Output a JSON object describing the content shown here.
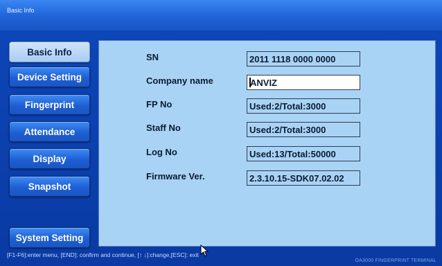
{
  "window": {
    "title": "Basic Info"
  },
  "sidebar": {
    "items": [
      {
        "label": "Basic Info"
      },
      {
        "label": "Device Setting"
      },
      {
        "label": "Fingerprint"
      },
      {
        "label": "Attendance"
      },
      {
        "label": "Display"
      },
      {
        "label": "Snapshot"
      },
      {
        "label": "System Setting"
      }
    ]
  },
  "info": {
    "fields": [
      {
        "label": "SN",
        "value": "2011 1118 0000 0000"
      },
      {
        "label": "Company name",
        "value": "ANVIZ"
      },
      {
        "label": "FP No",
        "value": "Used:2/Total:3000"
      },
      {
        "label": "Staff No",
        "value": "Used:2/Total:3000"
      },
      {
        "label": "Log No",
        "value": "Used:13/Total:50000"
      },
      {
        "label": "Firmware Ver.",
        "value": "2.3.10.15-SDK07.02.02"
      }
    ]
  },
  "status": {
    "hint": "[F1-F6]:enter menu, [END]: confirm and continue, [↑ ↓]:change,[ESC]: exit",
    "brand": "OA3000 FINGERPRINT TERMINAL"
  },
  "colors": {
    "frame": "#0d46b8",
    "content_bg": "#a9d3f4",
    "active_button": "#a9cdf3"
  }
}
